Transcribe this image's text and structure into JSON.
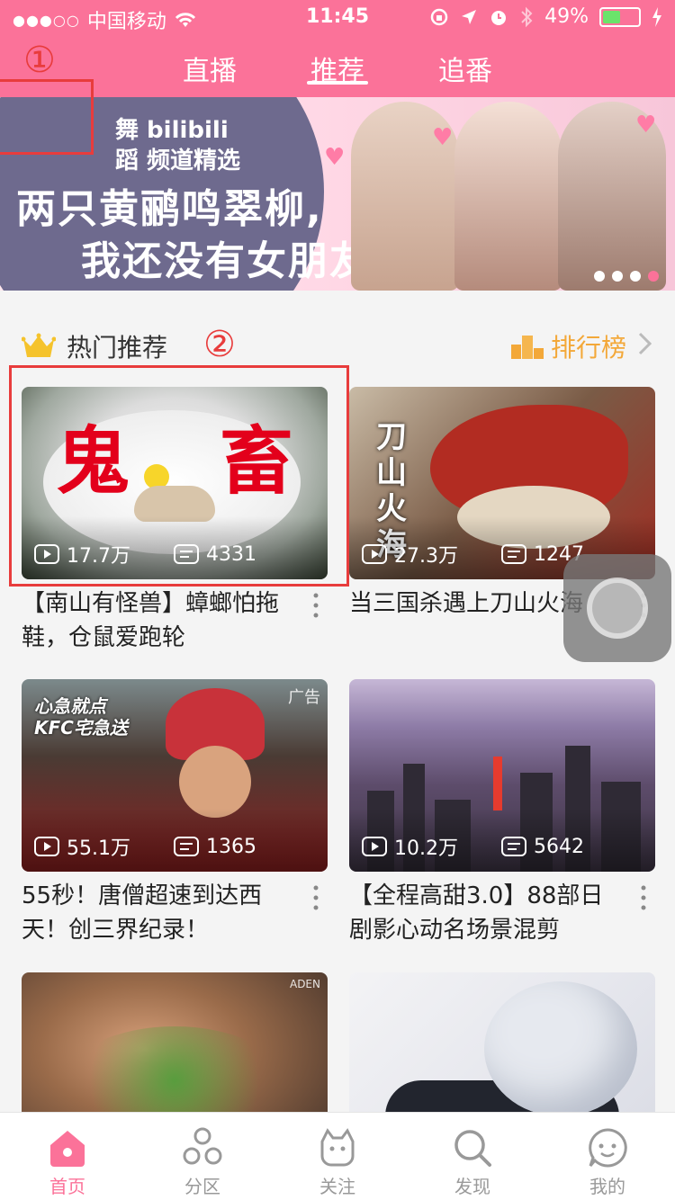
{
  "status_bar": {
    "carrier": "中国移动",
    "time": "11:45",
    "battery": "49%",
    "battery_level": 0.49
  },
  "header": {
    "tabs": [
      {
        "label": "直播"
      },
      {
        "label": "推荐"
      },
      {
        "label": "追番"
      }
    ],
    "active_tab": "推荐",
    "accent_color": "#fb7299"
  },
  "banner": {
    "line1": "舞 bilibili",
    "line2": "蹈 频道精选",
    "headline1": "两只黄鹂鸣翠柳,",
    "headline2": "我还没有女朋友",
    "pager_count": 4,
    "pager_active_index": 3
  },
  "annotations": [
    "①",
    "②"
  ],
  "section": {
    "title": "热门推荐",
    "rank_label": "排行榜"
  },
  "cards": [
    {
      "overlay_left": "鬼",
      "overlay_right": "畜",
      "views": "17.7万",
      "danmaku": "4331",
      "title": "【南山有怪兽】蟑螂怕拖鞋，仓鼠爱跑轮"
    },
    {
      "vertical_text": "刀山火海",
      "views": "27.3万",
      "danmaku": "1247",
      "title": "当三国杀遇上刀山火海"
    },
    {
      "badge": "广告",
      "brand_text": "心急就点 KFC宅急送",
      "views": "55.1万",
      "danmaku": "1365",
      "title": "55秒！唐僧超速到达西天！创三界纪录！"
    },
    {
      "views": "10.2万",
      "danmaku": "5642",
      "title": "【全程高甜3.0】88部日剧影心动名场景混剪"
    },
    {
      "badge": "ADEN"
    },
    {}
  ],
  "bottom_nav": [
    {
      "label": "首页"
    },
    {
      "label": "分区"
    },
    {
      "label": "关注"
    },
    {
      "label": "发现"
    },
    {
      "label": "我的"
    }
  ]
}
